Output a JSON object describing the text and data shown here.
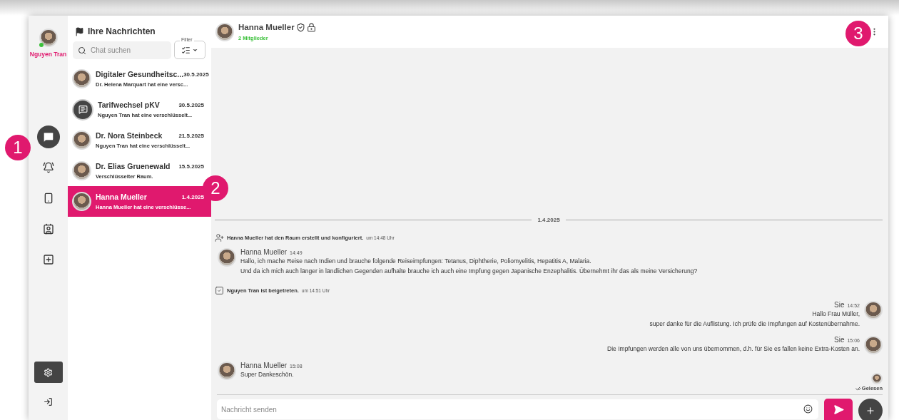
{
  "user": {
    "name": "Nguyen Tran",
    "online": true
  },
  "rail": {
    "items": [
      {
        "selected": true
      },
      {
        "selected": false
      },
      {
        "selected": false
      },
      {
        "selected": false
      },
      {
        "selected": false
      }
    ],
    "bottom_items": [
      {
        "selected": true
      },
      {
        "selected": false
      }
    ]
  },
  "chat_list": {
    "title": "Ihre Nachrichten",
    "search": {
      "placeholder": "Chat suchen"
    },
    "filter": {
      "label": "Filter"
    },
    "conversations": [
      {
        "kind": "photo",
        "name": "Digitaler Gesundheitsc...",
        "date": "30.5.2025",
        "preview": "Dr. Helena Marquart hat eine versc...",
        "selected": false
      },
      {
        "kind": "icon",
        "name": "Tarifwechsel pKV",
        "date": "30.5.2025",
        "preview": "Nguyen Tran hat eine verschlüsselt...",
        "selected": false
      },
      {
        "kind": "photo",
        "name": "Dr. Nora Steinbeck",
        "date": "21.5.2025",
        "preview": "Nguyen Tran hat eine verschlüsselt...",
        "selected": false
      },
      {
        "kind": "photo",
        "name": "Dr. Elias Gruenewald",
        "date": "15.5.2025",
        "preview": "Verschlüsselter Raum.",
        "selected": false
      },
      {
        "kind": "photo",
        "name": "Hanna Mueller",
        "date": "1.4.2025",
        "preview": "Hanna Mueller hat eine verschlüsse...",
        "selected": true
      }
    ]
  },
  "chat": {
    "title": "Hanna Mueller",
    "members": "2 Mitglieder",
    "events": [
      {
        "kind": "divider",
        "text": "1.4.2025"
      },
      {
        "kind": "created",
        "text": "Hanna Mueller hat den Raum erstellt und konfiguriert.",
        "time": "um 14:48 Uhr"
      },
      {
        "kind": "incoming",
        "sender": "Hanna Mueller",
        "time": "14:49",
        "lines": [
          "Hallo, ich mache Reise nach Indien und brauche folgende Reiseimpfungen: Tetanus, Diphtherie, Poliomyelitis, Hepatitis A, Malaria.",
          "Und da ich mich auch länger in ländlichen Gegenden aufhalte brauche ich auch eine Impfung gegen Japanische Enzephalitis. Übernehmt ihr das als meine Versicherung?"
        ]
      },
      {
        "kind": "joined",
        "text": "Nguyen Tran ist beigetreten.",
        "time": "um 14:51 Uhr"
      },
      {
        "kind": "outgoing",
        "sender": "Sie",
        "time": "14:52",
        "lines": [
          "Hallo Frau Müller,",
          "super danke für die Auflistung. Ich prüfe die Impfungen auf Kostenübernahme."
        ]
      },
      {
        "kind": "outgoing",
        "sender": "Sie",
        "time": "15:06",
        "lines": [
          "Die Impfungen werden alle von uns übernommen, d.h. für Sie es fallen keine Extra-Kosten an."
        ]
      },
      {
        "kind": "incoming",
        "sender": "Hanna Mueller",
        "time": "15:08",
        "lines": [
          "Super Dankeschön."
        ]
      }
    ],
    "read_receipt": "Gelesen",
    "composer": {
      "placeholder": "Nachricht senden"
    }
  },
  "callouts": [
    {
      "number": "1"
    },
    {
      "number": "2"
    },
    {
      "number": "3"
    }
  ]
}
